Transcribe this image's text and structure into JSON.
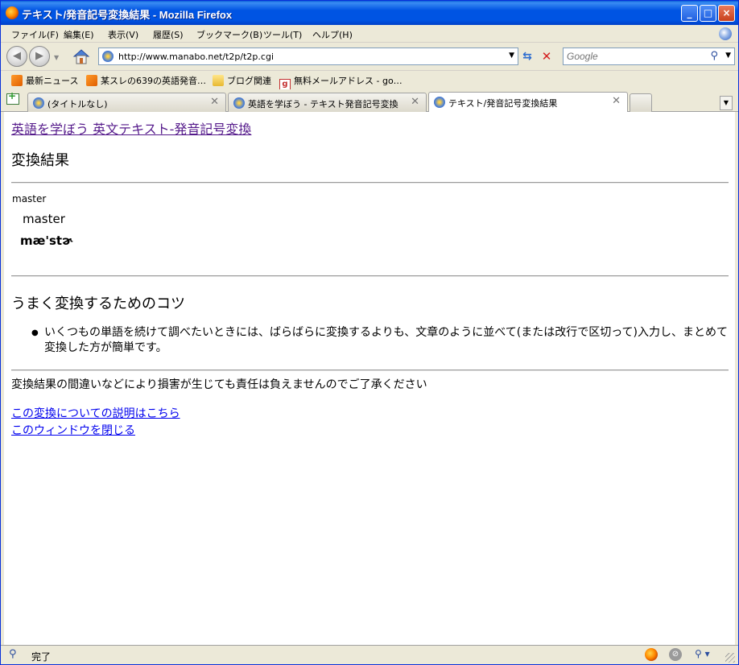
{
  "window": {
    "title": "テキスト/発音記号変換結果 - Mozilla Firefox"
  },
  "menu": [
    "ファイル(F)",
    "編集(E)",
    "表示(V)",
    "履歴(S)",
    "ブックマーク(B)",
    "ツール(T)",
    "ヘルプ(H)"
  ],
  "nav": {
    "url": "http://www.manabo.net/t2p/t2p.cgi",
    "search_placeholder": "Google"
  },
  "bookmarks": [
    {
      "label": "最新ニュース",
      "icon": "rss-icon"
    },
    {
      "label": "某スレの639の英語発音…",
      "icon": "rss-icon"
    },
    {
      "label": "ブログ関連",
      "icon": "folder-icon"
    },
    {
      "label": "無料メールアドレス - go…",
      "icon": "g-icon"
    }
  ],
  "tabs": [
    {
      "label": "(タイトルなし)",
      "active": false
    },
    {
      "label": "英語を学ぼう - テキスト発音記号変換",
      "active": false
    },
    {
      "label": "テキスト/発音記号変換結果",
      "active": true
    }
  ],
  "page": {
    "header_link": "英語を学ぼう 英文テキスト-発音記号変換",
    "result_heading": "変換結果",
    "source_word": "master",
    "word": "master",
    "ipa": "mæ'stɚ",
    "tips_heading": "うまく変換するためのコツ",
    "tips": [
      "いくつもの単語を続けて調べたいときには、ばらばらに変換するよりも、文章のように並べて(または改行で区切って)入力し、まとめて変換した方が簡単です。"
    ],
    "disclaimer": "変換結果の間違いなどにより損害が生じても責任は負えませんのでご了承ください",
    "link_explain": "この変換についての説明はこちら",
    "link_close": "このウィンドウを閉じる"
  },
  "status": {
    "text": "完了"
  },
  "colors": {
    "titlebar": "#0054e3",
    "visited_link": "#551a8b",
    "link": "#0000ee"
  }
}
